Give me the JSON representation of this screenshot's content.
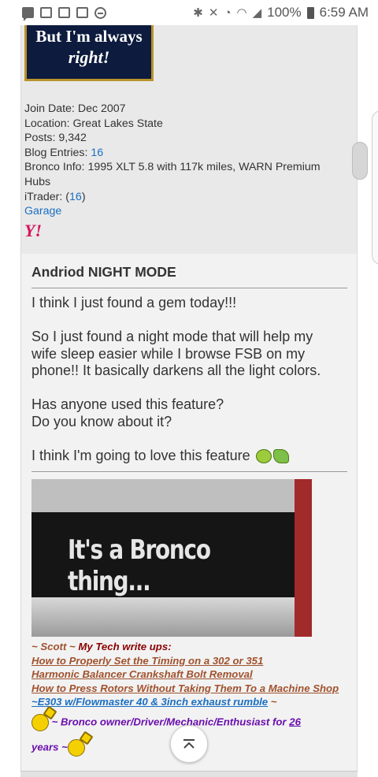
{
  "status_bar": {
    "battery": "100%",
    "time": "6:59 AM",
    "icons": [
      "chat-icon",
      "lock-icon",
      "mail-icon",
      "image-icon",
      "minus-circle-icon",
      "bluetooth-icon",
      "mute-icon",
      "alarm-icon",
      "wifi-icon",
      "signal-icon",
      "battery-icon"
    ]
  },
  "avatar": {
    "line1": "But I'm always",
    "line2": "right!"
  },
  "user_info": {
    "join_date": "Join Date: Dec 2007",
    "location": "Location: Great Lakes State",
    "posts": "Posts: 9,342",
    "blog_label": "Blog Entries: ",
    "blog_count": "16",
    "bronco_info_1": "Bronco Info: 1995 XLT 5.8 with 117k miles, WARN Premium",
    "bronco_info_2": "Hubs",
    "itrader_label": "iTrader: (",
    "itrader_count": "16",
    "itrader_close": ")",
    "garage": "Garage",
    "y_icon": "Y!"
  },
  "post": {
    "title": "Andriod NIGHT MODE",
    "lines": [
      "I think I just found a gem today!!!",
      "So I just found a night mode that will help my",
      "wife sleep easier while I browse FSB on my",
      "phone!! It basically darkens all the light colors.",
      "Has anyone used this feature?",
      "Do you know about it?",
      "I think I'm going to love this feature"
    ],
    "image_caption": "It's a Bronco thing..."
  },
  "signature": {
    "scott": "~ Scott ~",
    "tech_label": "My Tech write ups:",
    "links": [
      "How to Properly Set the Timing on a 302 or 351",
      "Harmonic Balancer Crankshaft Bolt Removal",
      "How to Press Rotors Without Taking Them To a Machine Shop"
    ],
    "e303": "~E303 w/Flowmaster 40 & 3inch exhaust rumble",
    "e303_tail": " ~",
    "owner": "~ Bronco owner/Driver/Mechanic/Enthusiast for ",
    "years_num": "26",
    "years": "years ~"
  },
  "colors": {
    "link_blue": "#1a6fc2",
    "sig_brown": "#a0522d",
    "sig_darkred": "#8b0000",
    "sig_purple": "#6a0dad"
  }
}
